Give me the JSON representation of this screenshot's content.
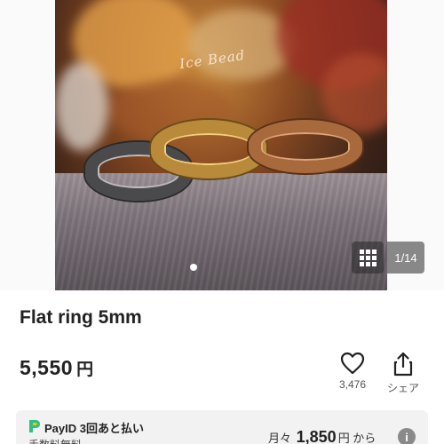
{
  "gallery": {
    "image_alt_signature": "Ice Bead",
    "counter": "1/14",
    "current_index": 1,
    "total_images": 14
  },
  "product": {
    "title": "Flat ring 5mm",
    "price_value": "5,550",
    "price_currency": "円"
  },
  "actions": {
    "like_count": "3,476",
    "share_label": "シェア",
    "like_icon": "heart-icon",
    "share_icon": "share-icon"
  },
  "payid": {
    "label": "PayID 3回あと払い",
    "sub": "手数料無料",
    "monthly_prefix": "月々",
    "monthly_amount": "1,850",
    "monthly_suffix": "円 から",
    "info_icon": "info-icon",
    "logo_color": "#2ec07e"
  }
}
